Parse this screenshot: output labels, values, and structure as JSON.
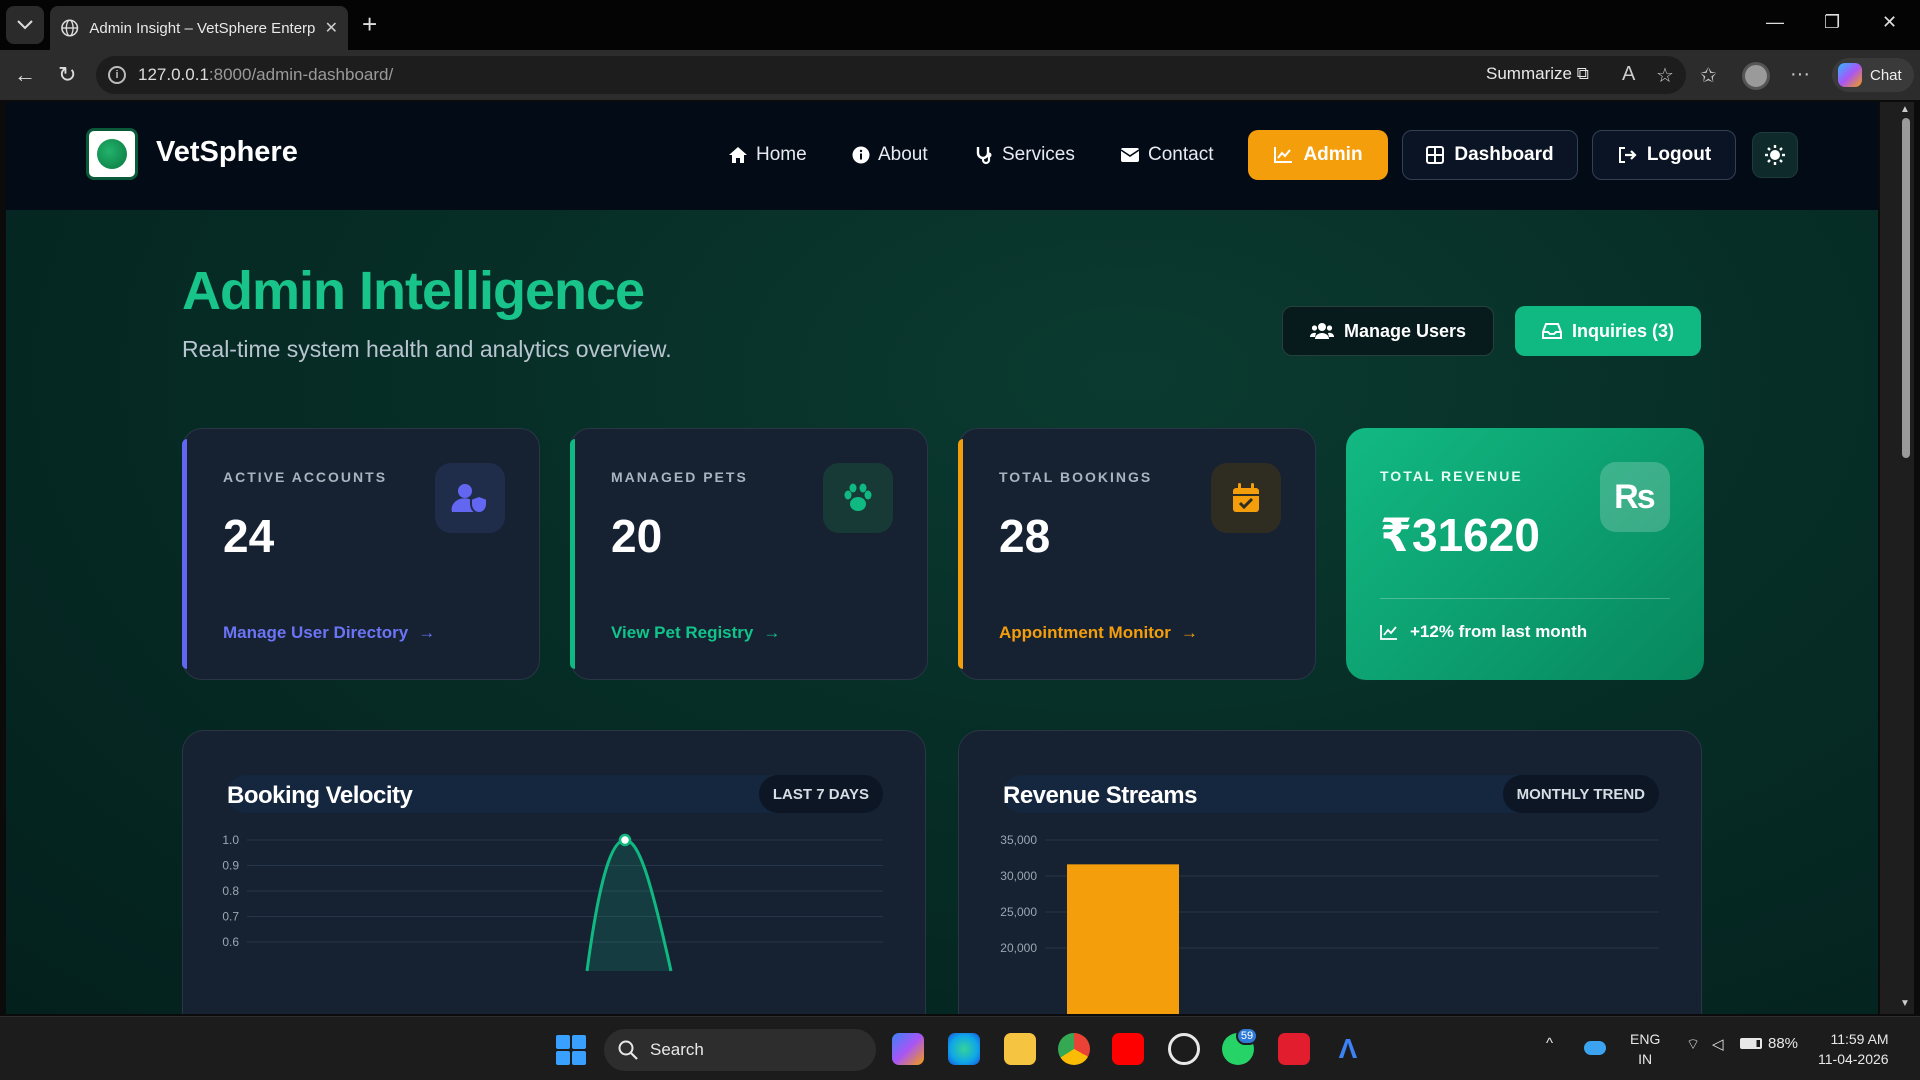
{
  "browser": {
    "tab_title": "Admin Insight – VetSphere Enterprise",
    "url_host": "127.0.0.1",
    "url_rest": ":8000/admin-dashboard/",
    "summarize_label": "Summarize",
    "chat_label": "Chat"
  },
  "site": {
    "brand": "VetSphere",
    "nav": {
      "home": "Home",
      "about": "About",
      "services": "Services",
      "contact": "Contact",
      "admin": "Admin",
      "dashboard": "Dashboard",
      "logout": "Logout"
    }
  },
  "hero": {
    "title": "Admin Intelligence",
    "subtitle": "Real-time system health and analytics overview.",
    "manage_users": "Manage Users",
    "inquiries": "Inquiries (3)"
  },
  "stats": {
    "accounts": {
      "label": "ACTIVE ACCOUNTS",
      "value": "24",
      "link": "Manage User Directory",
      "color": "#6366f1"
    },
    "pets": {
      "label": "MANAGED PETS",
      "value": "20",
      "link": "View Pet Registry",
      "color": "#10b981"
    },
    "bookings": {
      "label": "TOTAL BOOKINGS",
      "value": "28",
      "link": "Appointment Monitor",
      "color": "#f59e0b"
    },
    "revenue": {
      "label": "TOTAL REVENUE",
      "value": "₹31620",
      "trend": "+12% from last month",
      "icon_text": "₨"
    }
  },
  "panels": {
    "booking": {
      "title": "Booking Velocity",
      "pill": "LAST 7 DAYS"
    },
    "revenue": {
      "title": "Revenue Streams",
      "pill": "MONTHLY TREND"
    }
  },
  "chart_data": [
    {
      "type": "line",
      "title": "Booking Velocity",
      "ylim": [
        0.6,
        1.0
      ],
      "y_ticks": [
        "1.0",
        "0.9",
        "0.8",
        "0.7",
        "0.6"
      ],
      "peak": {
        "y": 1.0
      },
      "grid": true,
      "color": "#10b981"
    },
    {
      "type": "bar",
      "title": "Revenue Streams",
      "ylim": [
        20000,
        35000
      ],
      "y_ticks": [
        "35,000",
        "30,000",
        "25,000",
        "20,000"
      ],
      "values": [
        31620
      ],
      "grid": true,
      "color": "#f59e0b"
    }
  ],
  "taskbar": {
    "search": "Search",
    "whatsapp_badge": "59",
    "lang_top": "ENG",
    "lang_bottom": "IN",
    "battery": "88%",
    "time": "11:59 AM",
    "date": "11-04-2026"
  }
}
